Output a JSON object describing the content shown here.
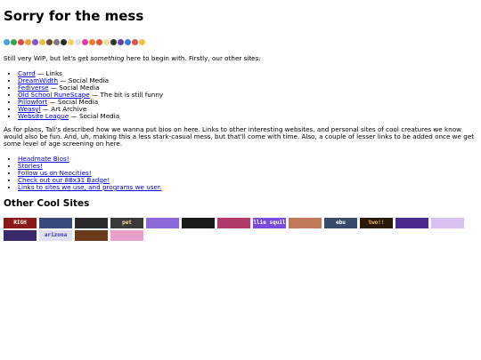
{
  "page": {
    "title": "Sorry for the mess",
    "emoji_strip": [
      "#4aa3d6",
      "#3ca34a",
      "#d94a4a",
      "#f0a030",
      "#8a4fc7",
      "#e8c048",
      "#6b4a2a",
      "#7a7a7a",
      "#2a2a2a",
      "#f0d070",
      "#e0e0e0",
      "#e0409a",
      "#f08030",
      "#d65a3a",
      "#f0e0a0",
      "#303030",
      "#6a3fa8",
      "#3a7ad8",
      "#e05050",
      "#f0c040"
    ],
    "intro_prefix": "Still very WIP, but let's get ",
    "intro_em": "something",
    "intro_suffix": " here to begin with. Firstly, our other sites:",
    "other_sites": [
      {
        "link": "Carrd",
        "desc": " — Links"
      },
      {
        "link": "DreamWidth",
        "desc": " — Social Media"
      },
      {
        "link": "Fediverse",
        "desc": " — Social Media"
      },
      {
        "link": "Old School RuneScape",
        "desc": " — The bit is still funny"
      },
      {
        "link": "Pillowfort",
        "desc": " — Social Media"
      },
      {
        "link": "Weasyl",
        "desc": " — Art Archive"
      },
      {
        "link": "Website League",
        "desc": " — Social Media"
      }
    ],
    "plans_text": "As for plans, Tali's described how we wanna put bios on here. Links to other interesting websites, and personal sites of cool creatures we know would also be fun. And, uh, making this a less stark-casual mess, but that'll come with time. Also, a couple of lesser links to be added once we get some level of age screening on here.",
    "more_links": [
      "Headmate Bios!",
      "Stories!",
      "Follow us on Neocities!",
      "Check out our 88x31 Badge!",
      "Links to sites we use, and programs we user."
    ],
    "cool_sites_heading": "Other Cool Sites",
    "badges": [
      {
        "text": "RIGH",
        "bg": "#8a1a1a",
        "fg": "#ffffff"
      },
      {
        "text": "",
        "bg": "#3a4a7a",
        "fg": "#ffffff"
      },
      {
        "text": "",
        "bg": "#2a2a2a",
        "fg": "#ffffff"
      },
      {
        "text": "pet",
        "bg": "#3a3a3a",
        "fg": "#ffe08a"
      },
      {
        "text": "",
        "bg": "#8a6ad8",
        "fg": "#ffffff"
      },
      {
        "text": "",
        "bg": "#1a1a1a",
        "fg": "#ffffff"
      },
      {
        "text": "",
        "bg": "#b03a6a",
        "fg": "#ffffff"
      },
      {
        "text": "millie squilly",
        "bg": "#7a4ad8",
        "fg": "#ffffff"
      },
      {
        "text": "",
        "bg": "#c07a5a",
        "fg": "#ffffff"
      },
      {
        "text": "ebu",
        "bg": "#3a4a6a",
        "fg": "#ffffff"
      },
      {
        "text": "two!!",
        "bg": "#2a1a0a",
        "fg": "#f0c040"
      },
      {
        "text": "",
        "bg": "#4a2a8a",
        "fg": "#ffffff"
      },
      {
        "text": "",
        "bg": "#d8c0f0",
        "fg": "#ffffff"
      },
      {
        "text": "",
        "bg": "#3a2a6a",
        "fg": "#ffffff"
      },
      {
        "text": "arizona",
        "bg": "#e0e0f0",
        "fg": "#3a3aa8"
      },
      {
        "text": "",
        "bg": "#6a3a1a",
        "fg": "#ffffff"
      },
      {
        "text": "",
        "bg": "#e8a0c8",
        "fg": "#ffffff"
      }
    ]
  }
}
